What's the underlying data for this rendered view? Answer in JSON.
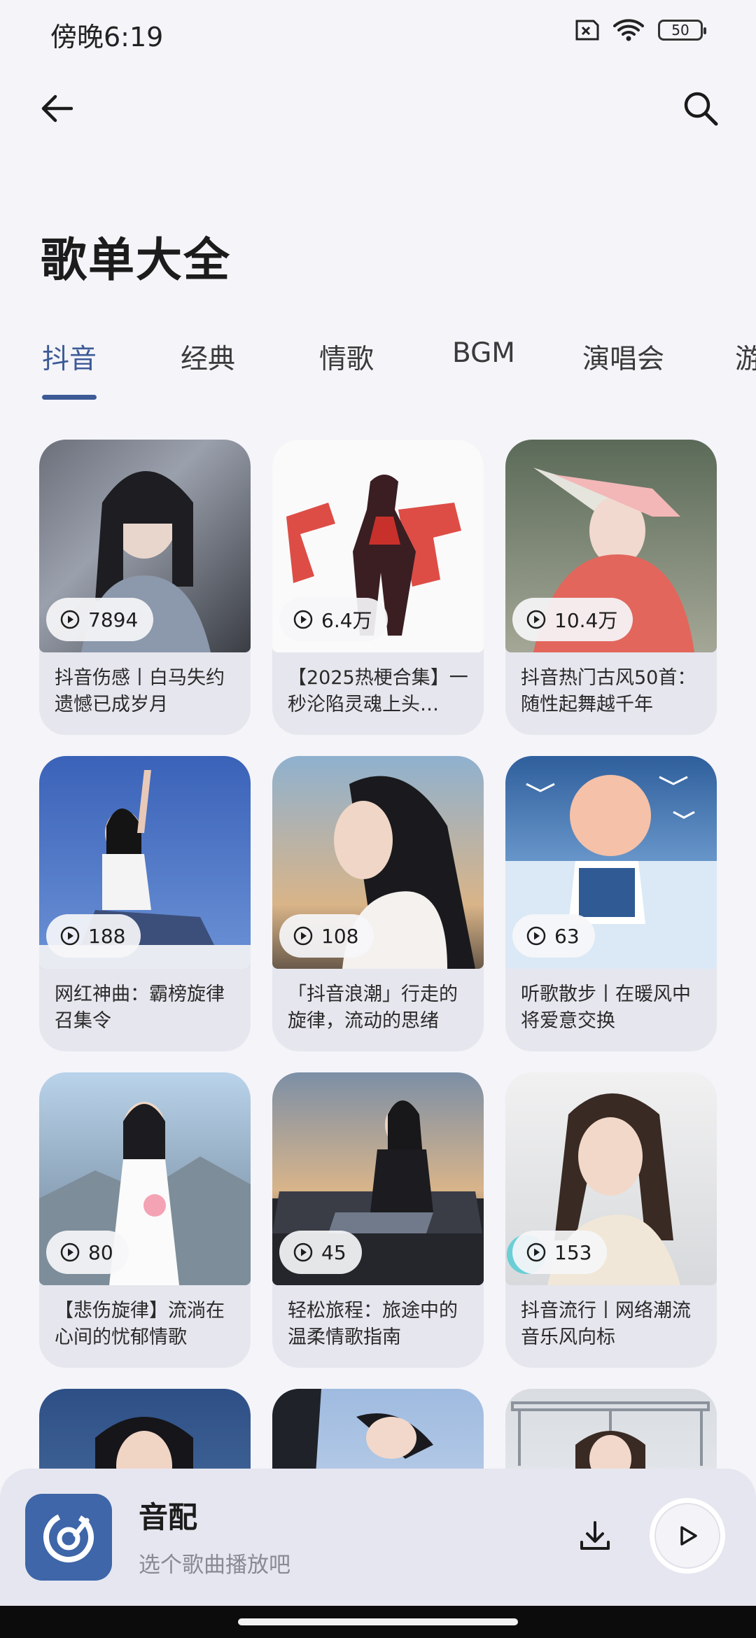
{
  "status_bar": {
    "time": "傍晚6:19",
    "battery": "50"
  },
  "page": {
    "title": "歌单大全"
  },
  "tabs": [
    {
      "label": "抖音",
      "active": true
    },
    {
      "label": "经典"
    },
    {
      "label": "情歌"
    },
    {
      "label": "BGM"
    },
    {
      "label": "演唱会"
    },
    {
      "label": "游"
    }
  ],
  "playlists": [
    {
      "plays": "7894",
      "title": "抖音伤感丨白马失约遗憾已成岁月"
    },
    {
      "plays": "6.4万",
      "title": "【2025热梗合集】一秒沦陷灵魂上头…"
    },
    {
      "plays": "10.4万",
      "title": "抖音热门古风50首：随性起舞越千年"
    },
    {
      "plays": "188",
      "title": "网红神曲：霸榜旋律召集令"
    },
    {
      "plays": "108",
      "title": "「抖音浪潮」行走的旋律，流动的思绪"
    },
    {
      "plays": "63",
      "title": "听歌散步丨在暖风中将爱意交换"
    },
    {
      "plays": "80",
      "title": "【悲伤旋律】流淌在心间的忧郁情歌"
    },
    {
      "plays": "45",
      "title": "轻松旅程：旅途中的温柔情歌指南"
    },
    {
      "plays": "153",
      "title": "抖音流行丨网络潮流音乐风向标"
    },
    {
      "plays": "",
      "title": ""
    },
    {
      "plays": "",
      "title": ""
    },
    {
      "plays": "",
      "title": ""
    }
  ],
  "player": {
    "title": "音配",
    "subtitle": "选个歌曲播放吧"
  },
  "colors": {
    "accent": "#3d5a96",
    "background": "#f4f4f9",
    "card": "#e6e6ee",
    "player_cover": "#3e66a8"
  },
  "icons": [
    "back-arrow-icon",
    "search-icon",
    "play-circle-icon",
    "download-icon",
    "play-icon",
    "wifi-icon",
    "sim-icon",
    "battery-icon"
  ]
}
